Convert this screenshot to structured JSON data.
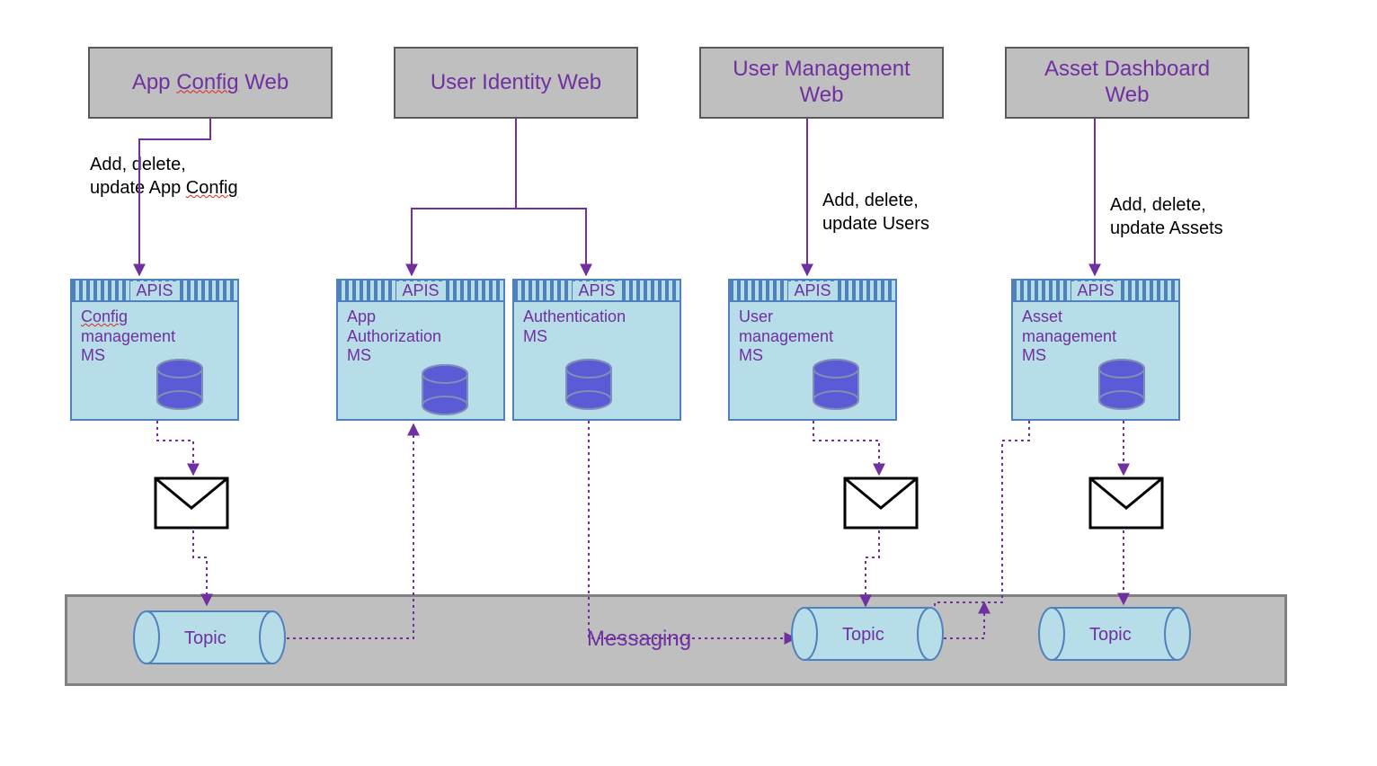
{
  "web_boxes": {
    "app_config": "App Config Web",
    "user_identity": "User Identity Web",
    "user_mgmt_line1": "User Management",
    "user_mgmt_line2": "Web",
    "asset_dash_line1": "Asset Dashboard",
    "asset_dash_line2": "Web"
  },
  "labels": {
    "app_config_l1": "Add, delete,",
    "app_config_l2": "update App Config",
    "users_l1": "Add, delete,",
    "users_l2": "update Users",
    "assets_l1": "Add, delete,",
    "assets_l2": "update Assets"
  },
  "apis_label": "APIS",
  "ms": {
    "config_l1": "Config",
    "config_l2": "management",
    "config_l3": "MS",
    "authz_l1": "App",
    "authz_l2": "Authorization",
    "authz_l3": "MS",
    "authn_l1": "Authentication",
    "authn_l2": "MS",
    "user_l1": "User",
    "user_l2": "management",
    "user_l3": "MS",
    "asset_l1": "Asset",
    "asset_l2": "management",
    "asset_l3": "MS"
  },
  "topic_label": "Topic",
  "messaging_label": "Messaging",
  "colors": {
    "purple": "#7030a0",
    "box_grey": "#bfbfbf",
    "box_border": "#595959",
    "ms_fill": "#b6dde8",
    "ms_border": "#4f81bd",
    "db_fill": "#5b5bd6",
    "db_stroke": "#7f8fb5"
  }
}
